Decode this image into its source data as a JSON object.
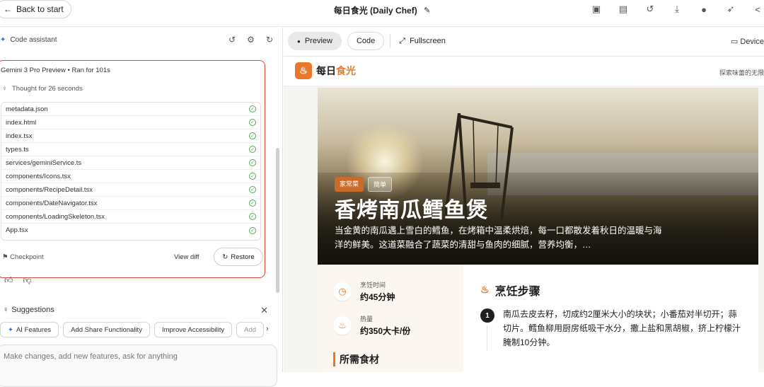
{
  "topbar": {
    "back_label": "Back to start",
    "app_title": "每日食光 (Daily Chef)"
  },
  "left": {
    "panel_title": "Code assistant",
    "run_model": "Gemini 3 Pro Preview",
    "run_time": "Ran for 101s",
    "thought": "Thought for 26 seconds",
    "files": [
      "metadata.json",
      "index.html",
      "index.tsx",
      "types.ts",
      "services/geminiService.ts",
      "components/Icons.tsx",
      "components/RecipeDetail.tsx",
      "components/DateNavigator.tsx",
      "components/LoadingSkeleton.tsx",
      "App.tsx"
    ],
    "checkpoint": "Checkpoint",
    "view_diff": "View diff",
    "restore": "Restore",
    "suggestions_title": "Suggestions",
    "chips": [
      "AI Features",
      "Add Share Functionality",
      "Improve Accessibility",
      "Add"
    ],
    "input_placeholder": "Make changes, add new features, ask for anything"
  },
  "right": {
    "tab_preview": "Preview",
    "tab_code": "Code",
    "fullscreen": "Fullscreen",
    "device": "Device"
  },
  "app": {
    "logo_text_a": "每日",
    "logo_text_b": "食光",
    "tagline": "探索味蕾的无限",
    "tags": [
      "家常菜",
      "简单"
    ],
    "title": "香烤南瓜鳕鱼煲",
    "description": "当金黄的南瓜遇上雪白的鳕鱼，在烤箱中温柔烘焙，每一口都散发着秋日的温暖与海洋的鲜美。这道菜融合了蔬菜的清甜与鱼肉的细腻，营养均衡，…",
    "cook_time_label": "烹饪时间",
    "cook_time_value": "约45分钟",
    "calories_label": "热量",
    "calories_value": "约350大卡/份",
    "ingredients_title": "所需食材",
    "steps_title": "烹饪步骤",
    "step1_num": "1",
    "step1_text": "南瓜去皮去籽，切成约2厘米大小的块状；小番茄对半切开；蒜切片。鳕鱼柳用厨房纸吸干水分，撒上盐和黑胡椒，挤上柠檬汁腌制10分钟。"
  },
  "colors": {
    "accent": "#e8792c",
    "highlight_border": "#e0463a"
  }
}
